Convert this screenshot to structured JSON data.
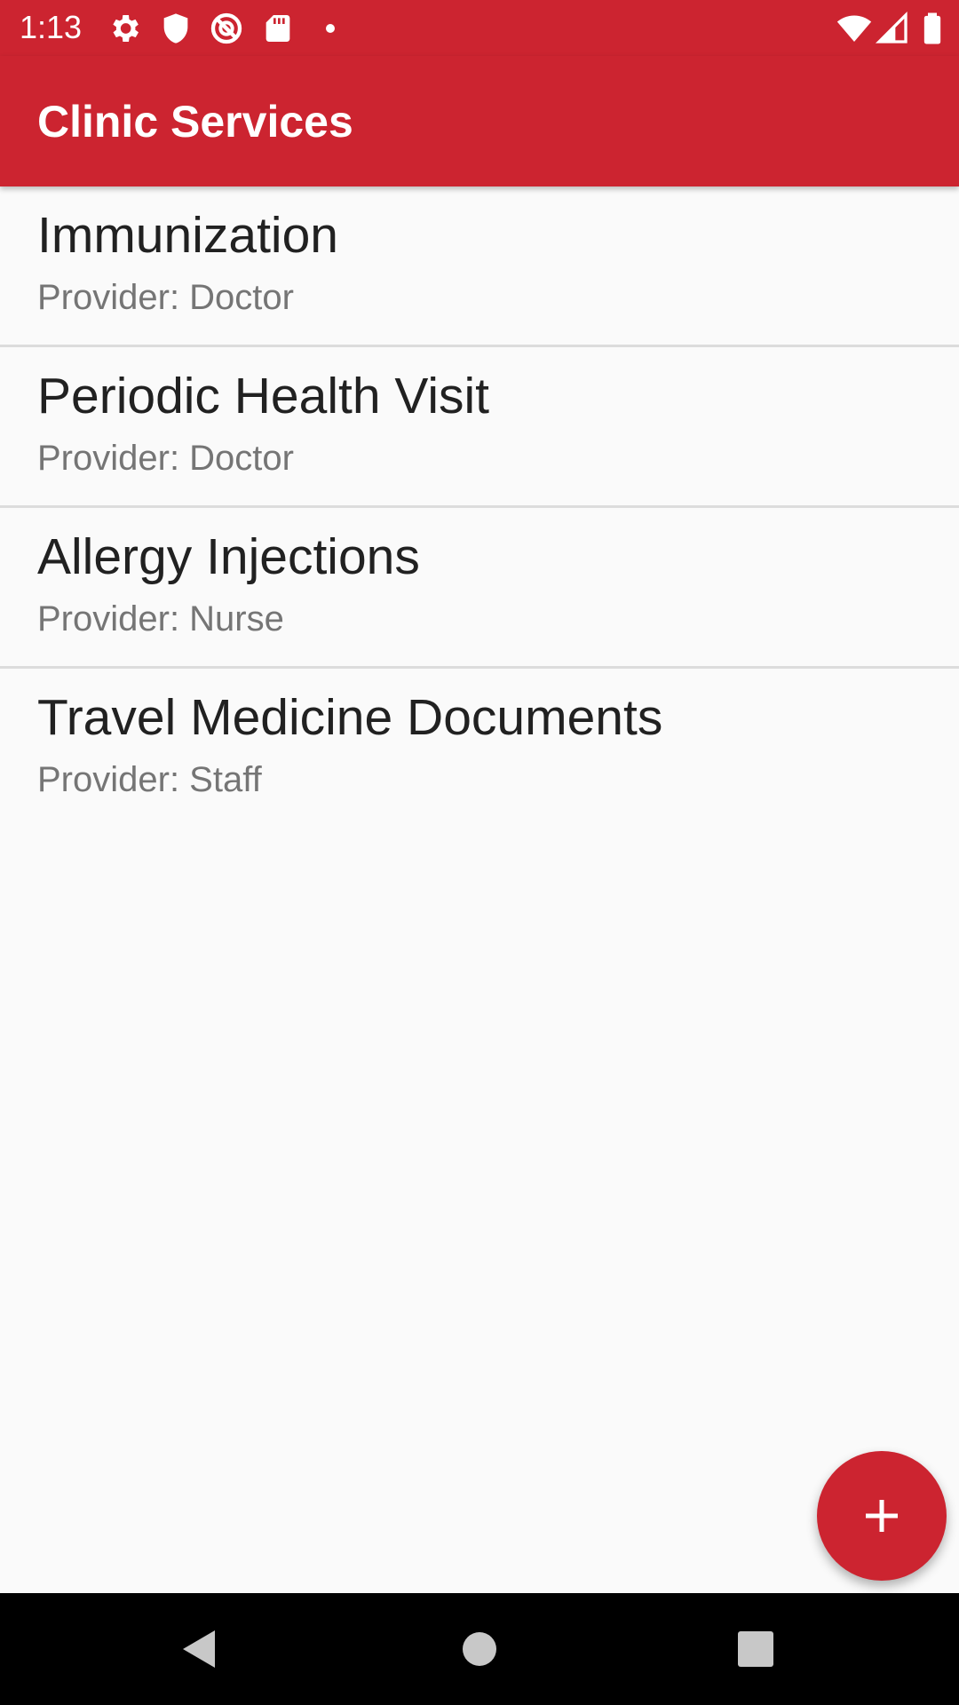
{
  "status_bar": {
    "time": "1:13",
    "icons": [
      "gear-icon",
      "shield-icon",
      "blocked-icon",
      "sd-card-icon",
      "notification-dot-icon",
      "wifi-icon",
      "cell-signal-icon",
      "battery-icon"
    ]
  },
  "app_bar": {
    "title": "Clinic Services"
  },
  "services": [
    {
      "name": "Immunization",
      "provider": "Provider: Doctor"
    },
    {
      "name": "Periodic Health Visit",
      "provider": "Provider: Doctor"
    },
    {
      "name": "Allergy Injections",
      "provider": "Provider: Nurse"
    },
    {
      "name": "Travel Medicine Documents",
      "provider": "Provider: Staff"
    }
  ],
  "fab": {
    "icon": "plus-icon"
  },
  "nav_bar": {
    "icons": [
      "back-icon",
      "home-icon",
      "recents-icon"
    ]
  },
  "colors": {
    "primary": "#cc2430",
    "background": "#fafafa",
    "title_text": "#212121",
    "subtitle_text": "#757575",
    "divider": "#dcdcdc"
  }
}
